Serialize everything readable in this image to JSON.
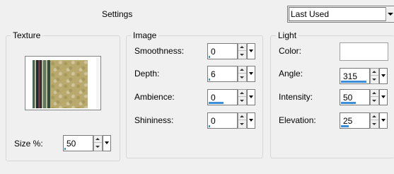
{
  "header": {
    "settings_label": "Settings",
    "preset": {
      "selected": "Last Used"
    }
  },
  "texture": {
    "title": "Texture",
    "size_label": "Size %:",
    "size_value": "50",
    "size_fraction": 0.0
  },
  "image": {
    "title": "Image",
    "fields": [
      {
        "label": "Smoothness:",
        "value": "0",
        "fraction": 0.0
      },
      {
        "label": "Depth:",
        "value": "6",
        "fraction": 0.06
      },
      {
        "label": "Ambience:",
        "value": "0",
        "fraction": 0.5
      },
      {
        "label": "Shininess:",
        "value": "0",
        "fraction": 0.0
      }
    ]
  },
  "light": {
    "title": "Light",
    "color_label": "Color:",
    "color_value": "#ffffff",
    "fields": [
      {
        "label": "Angle:",
        "value": "315",
        "fraction": 0.875
      },
      {
        "label": "Intensity:",
        "value": "50",
        "fraction": 0.5
      },
      {
        "label": "Elevation:",
        "value": "25",
        "fraction": 0.28
      }
    ]
  },
  "colors": {
    "accent": "#3c8ed9",
    "background": "#f0f0f0"
  }
}
